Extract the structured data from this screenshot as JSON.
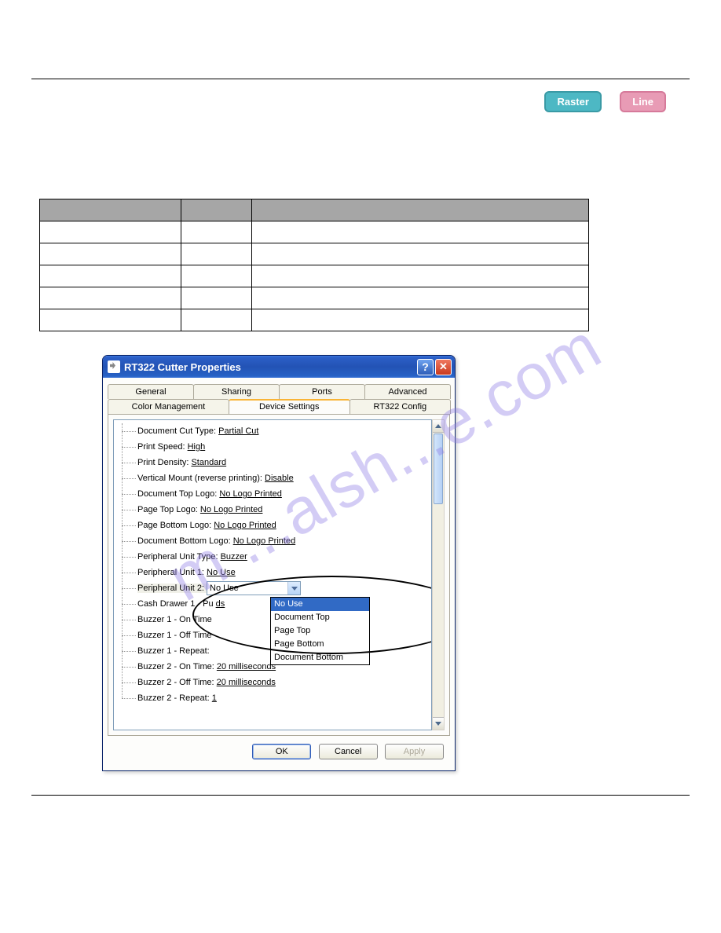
{
  "badges": {
    "raster": "Raster",
    "line": "Line"
  },
  "watermark": "m ...alsh...e.com",
  "window": {
    "title": "RT322 Cutter Properties",
    "tabs_row1": [
      "General",
      "Sharing",
      "Ports",
      "Advanced"
    ],
    "tabs_row2": [
      "Color Management",
      "Device Settings",
      "RT322 Config"
    ],
    "active_tab": "Device Settings",
    "settings": [
      {
        "label": "Document Cut Type:",
        "value": "Partial Cut"
      },
      {
        "label": "Print Speed:",
        "value": "High"
      },
      {
        "label": "Print Density:",
        "value": "Standard"
      },
      {
        "label": "Vertical Mount (reverse printing):",
        "value": "Disable"
      },
      {
        "label": "Document Top Logo:",
        "value": "No Logo Printed"
      },
      {
        "label": "Page Top Logo:",
        "value": "No Logo Printed"
      },
      {
        "label": "Page Bottom Logo:",
        "value": "No Logo Printed"
      },
      {
        "label": "Document Bottom Logo:",
        "value": "No Logo Printed"
      },
      {
        "label": "Peripheral Unit Type:",
        "value": "Buzzer"
      },
      {
        "label": "Peripheral Unit 1:",
        "value": "No Use"
      },
      {
        "label": "Peripheral Unit 2:",
        "value": "No Use",
        "combo": true
      },
      {
        "label": "Cash Drawer 1 - Pu",
        "value": "ds",
        "overlaid": true
      },
      {
        "label": "Buzzer 1 - On Time",
        "value": "",
        "overlaid": true
      },
      {
        "label": "Buzzer 1 - Off Time",
        "value": "",
        "overlaid": true
      },
      {
        "label": "Buzzer 1 - Repeat:",
        "value": "",
        "overlaid": true
      },
      {
        "label": "Buzzer 2 - On Time:",
        "value": "20 milliseconds"
      },
      {
        "label": "Buzzer 2 - Off Time:",
        "value": "20 milliseconds"
      },
      {
        "label": "Buzzer 2 - Repeat:",
        "value": "1"
      }
    ],
    "dropdown_options": [
      "No Use",
      "Document Top",
      "Page Top",
      "Page Bottom",
      "Document Bottom"
    ],
    "dropdown_selected": "No Use",
    "buttons": {
      "ok": "OK",
      "cancel": "Cancel",
      "apply": "Apply"
    }
  }
}
